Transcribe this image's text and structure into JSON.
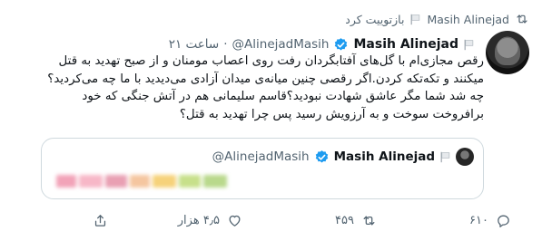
{
  "retweet_bar": {
    "retweeter": "Masih Alinejad",
    "label": "بازتوییت کرد"
  },
  "tweet": {
    "author_name": "Masih Alinejad",
    "handle": "@AlinejadMasih",
    "separator": "·",
    "timestamp": "۲۱ ساعت",
    "text": "رقص مجازی‌ام با گل‌های آفتابگردان رفت روی اعصاب مومنان و از صبح  تهدید به قتل میکنند و تکه‌تکه کردن.اگر رقصی چنین میانه‌ی میدان آزادی می‌دیدید با ما چه می‌کردید؟ چه شد شما مگر عاشق شهادت نبودید؟قاسم سلیمانی هم در آتش جنگی که خود برافروخت سوخت و به آرزویش رسید پس چرا تهدید به قتل؟"
  },
  "quoted_tweet": {
    "author_name": "Masih Alinejad",
    "handle": "@AlinejadMasih"
  },
  "actions": {
    "reply_count": "۶۱۰",
    "retweet_count": "۴۵۹",
    "like_count": "۴٫۵ هزار"
  },
  "colors": {
    "accent": "#1d9bf0",
    "muted": "#536471",
    "text": "#0f1419",
    "border": "#cfd9de"
  }
}
